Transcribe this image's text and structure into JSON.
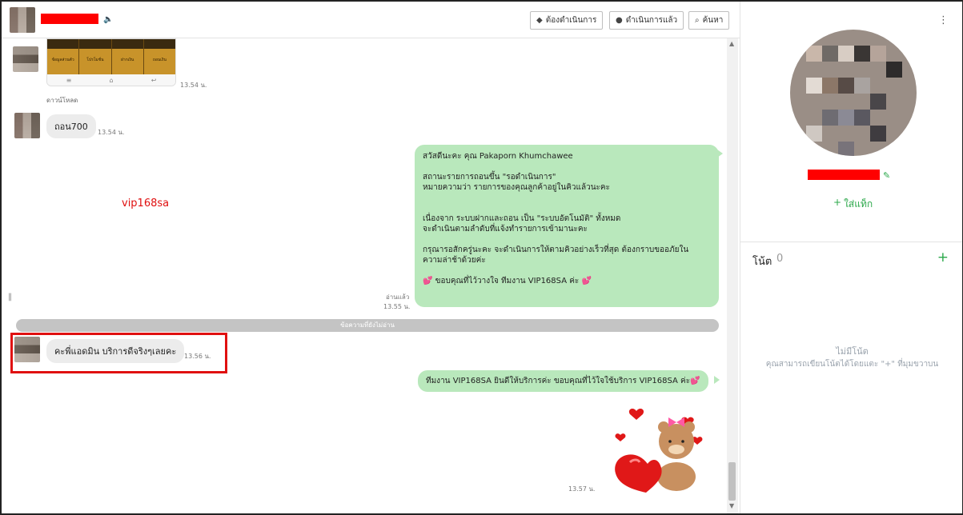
{
  "header": {
    "speaker_icon": "speaker-icon",
    "buttons": [
      {
        "label": "ต้องดำเนินการ",
        "icon": "tag-icon"
      },
      {
        "label": "ดำเนินการแล้ว",
        "icon": "chat-icon"
      },
      {
        "label": "ค้นหา",
        "icon": "search-icon"
      }
    ]
  },
  "messages": {
    "image_time": "13.54 น.",
    "image_cells": [
      "ข้อมูลส่วนตัว",
      "โปรโมชั่น",
      "ฝากเงิน",
      "ถอนเงิน"
    ],
    "download_label": "ดาวน์โหลด",
    "withdraw_text": "ถอน700",
    "withdraw_time": "13.54 น.",
    "watermark": "vip168sa",
    "long_reply": "สวัสดีนะคะ คุณ Pakaporn  Khumchawee\n\n     สถานะรายการถอนขึ้น \"รอดำเนินการ\"\nหมายความว่า รายการของคุณลูกค้าอยู่ในคิวแล้วนะคะ\n\n\n     เนื่องจาก ระบบฝากและถอน เป็น \"ระบบอัตโนมัติ\" ทั้งหมด\nจะดำเนินตามลำดับที่แจ้งทำรายการเข้ามานะคะ\n\n     กรุณารอสักครู่นะคะ จะดำเนินการให้ตามคิวอย่างเร็วที่สุด ต้องกราบขออภัยใน\nความล่าช้าด้วยค่ะ\n\n        💕 ขอบคุณที่ไว้วางใจ ทีมงาน VIP168SA ค่ะ 💕",
    "read_label": "อ่านแล้ว",
    "long_reply_time": "13.55 น.",
    "unread_label": "ข้อความที่ยังไม่อ่าน",
    "praise_text": "คะพี่แอดมิน  บริการดีจริงๆเลยคะ",
    "praise_time": "13.56 น.",
    "thanks_text": "ทีมงาน VIP168SA ยินดีให้บริการค่ะ ขอบคุณที่ไว้ใจใช้บริการ VIP168SA ค่ะ💕",
    "sticker_time": "13.57 น."
  },
  "profile": {
    "add_tag": "ใส่แท็ก",
    "notes_title": "โน้ต",
    "notes_count": "0",
    "no_notes": "ไม่มีโน้ต",
    "no_notes_hint": "คุณสามารถเขียนโน้ตได้โดยแตะ \"+\" ที่มุมขวาบน"
  },
  "colors": {
    "accent_green": "#2ba84a",
    "outgoing_bubble": "#b9e8bc",
    "highlight_red": "#e01010"
  }
}
